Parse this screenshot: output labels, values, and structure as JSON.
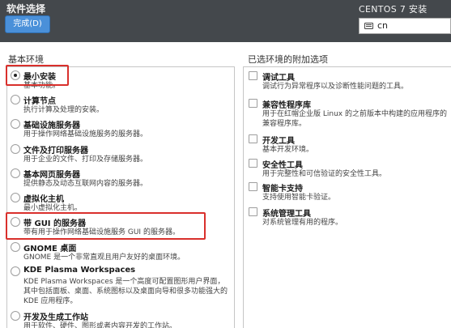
{
  "header": {
    "title": "软件选择",
    "done_label": "完成(D)",
    "os_title": "CENTOS 7 安装",
    "language_value": "cn",
    "keyboard_icon": "keyboard-icon"
  },
  "base_env": {
    "label": "基本环境",
    "items": [
      {
        "name": "最小安装",
        "desc": "基本功能。",
        "checked": true
      },
      {
        "name": "计算节点",
        "desc": "执行计算及处理的安装。",
        "checked": false
      },
      {
        "name": "基础设施服务器",
        "desc": "用于操作网络基础设施服务的服务器。",
        "checked": false
      },
      {
        "name": "文件及打印服务器",
        "desc": "用于企业的文件、打印及存储服务器。",
        "checked": false
      },
      {
        "name": "基本网页服务器",
        "desc": "提供静态及动态互联网内容的服务器。",
        "checked": false
      },
      {
        "name": "虚拟化主机",
        "desc": "最小虚拟化主机。",
        "checked": false
      },
      {
        "name": "带 GUI 的服务器",
        "desc": "带有用于操作网络基础设施服务 GUI 的服务器。",
        "checked": false
      },
      {
        "name": "GNOME 桌面",
        "desc": "GNOME 是一个非常直观且用户友好的桌面环境。",
        "checked": false
      },
      {
        "name": "KDE Plasma Workspaces",
        "desc": "KDE Plasma Workspaces 是一个高度可配置图形用户界面，其中包括面板、桌面、系统图标以及桌面向导和很多功能强大的 KDE 应用程序。",
        "checked": false
      },
      {
        "name": "开发及生成工作站",
        "desc": "用于软件、硬件、图形或者内容开发的工作站。",
        "checked": false
      }
    ]
  },
  "addons": {
    "label": "已选环境的附加选项",
    "items": [
      {
        "name": "调试工具",
        "desc": "调试行为异常程序以及诊断性能问题的工具。"
      },
      {
        "name": "兼容性程序库",
        "desc": "用于在红帽企业版 Linux 的之前版本中构建的应用程序的兼容程序库。"
      },
      {
        "name": "开发工具",
        "desc": "基本开发环境。"
      },
      {
        "name": "安全性工具",
        "desc": "用于完整性和可信验证的安全性工具。"
      },
      {
        "name": "智能卡支持",
        "desc": "支持使用智能卡验证。"
      },
      {
        "name": "系统管理工具",
        "desc": "对系统管理有用的程序。"
      }
    ]
  },
  "colors": {
    "topbar": "#44484c",
    "done_button": "#4a90d9",
    "highlight": "#d9302c"
  }
}
